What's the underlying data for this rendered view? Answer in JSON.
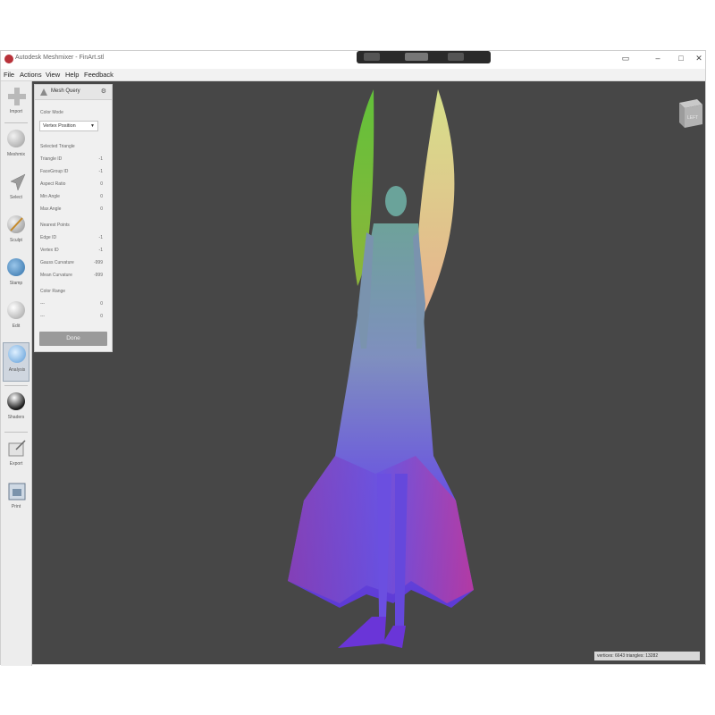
{
  "window": {
    "title": "Autodesk Meshmixer - FinArt.stl"
  },
  "menu": [
    "File",
    "Actions",
    "View",
    "Help",
    "Feedback"
  ],
  "tools": [
    {
      "label": "Import",
      "icon": "plus-icon"
    },
    {
      "label": "Meshmix",
      "icon": "meshmix-icon"
    },
    {
      "label": "Select",
      "icon": "select-arrow-icon"
    },
    {
      "label": "Sculpt",
      "icon": "brush-icon"
    },
    {
      "label": "Stamp",
      "icon": "stamp-icon"
    },
    {
      "label": "Edit",
      "icon": "edit-sphere-icon"
    },
    {
      "label": "Analysis",
      "icon": "analysis-icon"
    },
    {
      "label": "Shaders",
      "icon": "shader-sphere-icon"
    },
    {
      "label": "Export",
      "icon": "export-icon"
    },
    {
      "label": "Print",
      "icon": "print-icon"
    }
  ],
  "panel": {
    "title": "Mesh Query",
    "color_mode_label": "Color Mode",
    "color_mode_value": "Vertex Position",
    "selected_triangle_label": "Selected Triangle",
    "rows_triangle": [
      {
        "label": "Triangle ID",
        "value": "-1"
      },
      {
        "label": "FaceGroup ID",
        "value": "-1"
      },
      {
        "label": "Aspect Ratio",
        "value": "0"
      },
      {
        "label": "Min Angle",
        "value": "0"
      },
      {
        "label": "Max Angle",
        "value": "0"
      }
    ],
    "nearest_points_label": "Nearest Points",
    "rows_points": [
      {
        "label": "Edge ID",
        "value": "-1"
      },
      {
        "label": "Vertex ID",
        "value": "-1"
      },
      {
        "label": "Gauss Curvature",
        "value": "-999"
      },
      {
        "label": "Mean Curvature",
        "value": "-999"
      }
    ],
    "color_range_label": "Color Range",
    "rows_range": [
      {
        "label": "---",
        "value": "0"
      },
      {
        "label": "---",
        "value": "0"
      }
    ],
    "done_label": "Done"
  },
  "viewcube_label": "LEFT",
  "status_text": "vertices: 6643 triangles: 13282",
  "colors": {
    "viewport_bg": "#474747",
    "wing_green": "#6fbf3a",
    "wing_peach": "#e6b88a",
    "body_teal": "#6e9e9a",
    "dress_purple": "#6a5ae0",
    "dress_magenta": "#c2399a"
  }
}
